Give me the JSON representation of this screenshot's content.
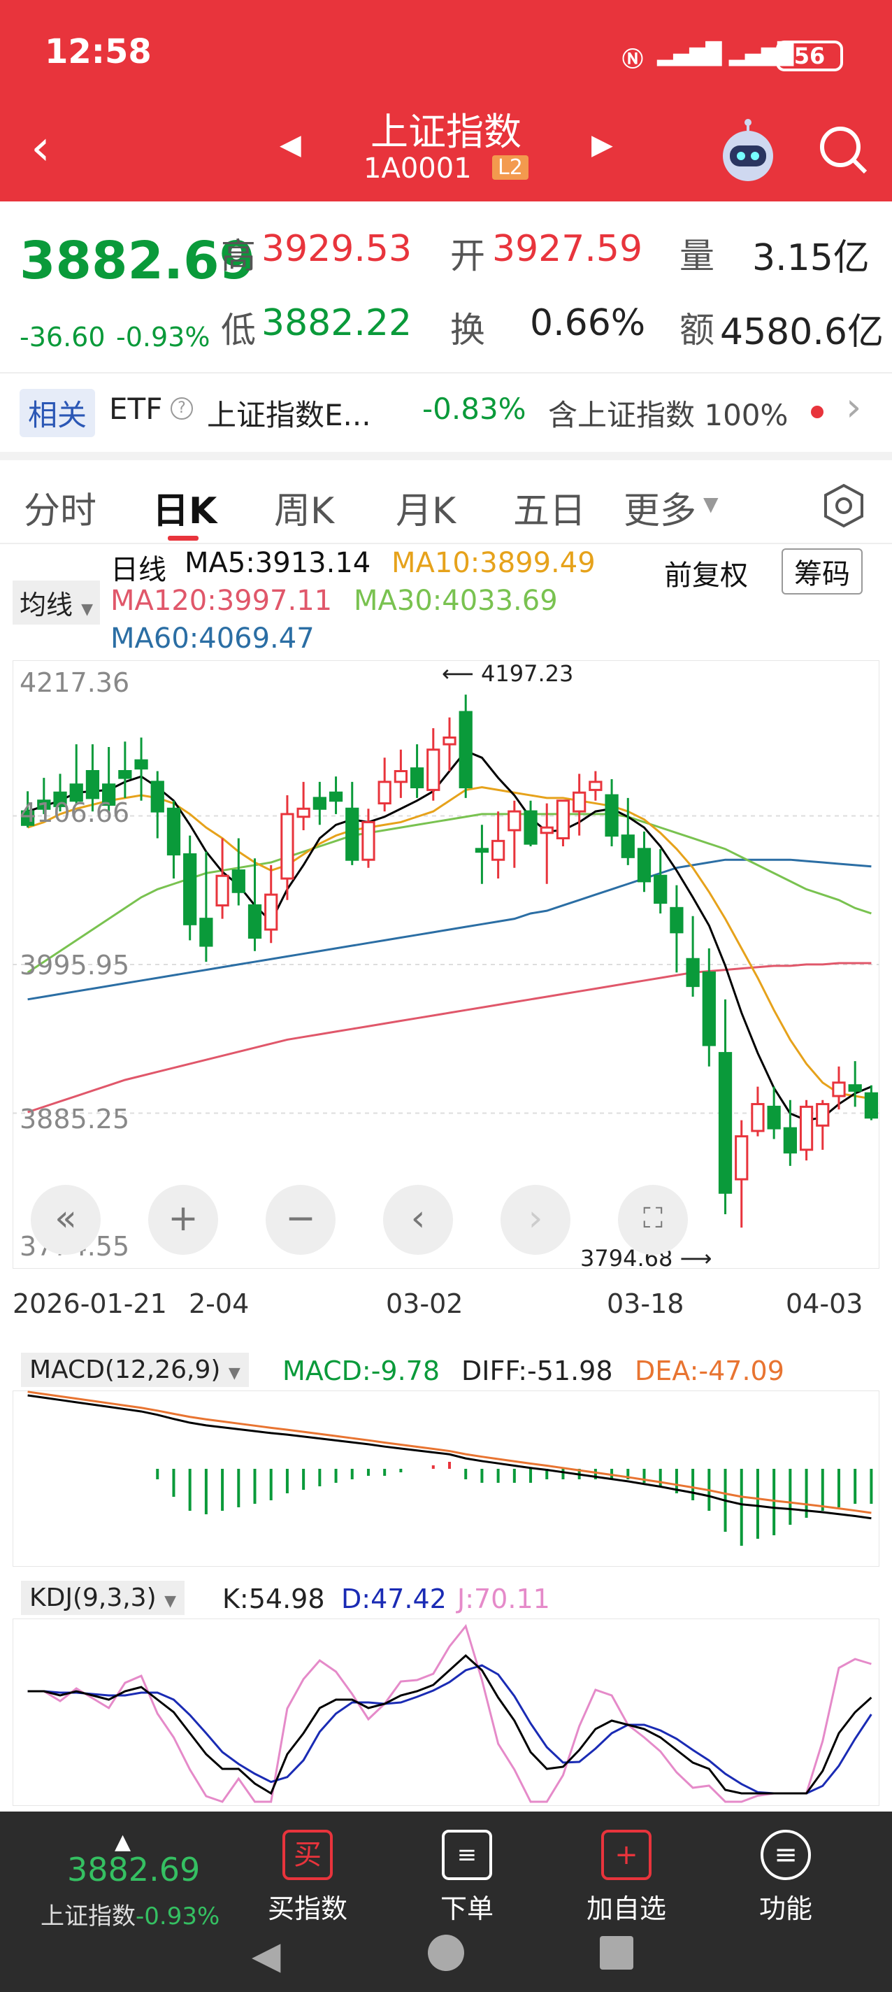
{
  "status": {
    "time": "12:58",
    "signal": "5A 5A",
    "battery": "56"
  },
  "nav": {
    "title": "上证指数",
    "code": "1A0001",
    "badge": "L2"
  },
  "quote": {
    "price": "3882.69",
    "change": "-36.60",
    "change_pct": "-0.93%",
    "high_label": "高",
    "high": "3929.53",
    "low_label": "低",
    "low": "3882.22",
    "open_label": "开",
    "open": "3927.59",
    "turnover_label": "换",
    "turnover": "0.66%",
    "volume_label": "量",
    "volume": "3.15亿",
    "amount_label": "额",
    "amount": "4580.6亿"
  },
  "related": {
    "tag": "相关",
    "etf_label": "ETF",
    "etf_name": "上证指数E...",
    "etf_change": "-0.83%",
    "contains": "含上证指数 100%"
  },
  "tabs": [
    "分时",
    "日K",
    "周K",
    "月K",
    "五日",
    "更多"
  ],
  "chart": {
    "line_type": "日线",
    "ma5": "MA5:3913.14",
    "ma10": "MA10:3899.49",
    "ma120": "MA120:3997.11",
    "ma30": "MA30:4033.69",
    "ma60": "MA60:4069.47",
    "adjust": "前复权",
    "chip_button": "筹码",
    "avg_dropdown": "均线",
    "y_ticks": [
      "4217.36",
      "4106.66",
      "3995.95",
      "3885.25",
      "3774.55"
    ],
    "max_label": "4197.23",
    "min_label": "3794.68",
    "x_ticks": [
      "2026-01-21",
      "2-04",
      "03-02",
      "03-18",
      "04-03"
    ],
    "colors": {
      "up": "#e8343c",
      "down": "#0a9a3a",
      "ma5": "#000000",
      "ma10": "#e6a21b",
      "ma30": "#79c250",
      "ma60": "#2b6ea4",
      "ma120": "#e0576a"
    }
  },
  "chart_data": {
    "type": "candlestick",
    "ylim": [
      3774.55,
      4217.36
    ],
    "candles": [
      [
        4110,
        4125,
        4100,
        4098
      ],
      [
        4118,
        4135,
        4112,
        4108
      ],
      [
        4124,
        4138,
        4114,
        4110
      ],
      [
        4130,
        4160,
        4118,
        4115
      ],
      [
        4140,
        4160,
        4120,
        4110
      ],
      [
        4130,
        4158,
        4115,
        4110
      ],
      [
        4140,
        4162,
        4135,
        4120
      ],
      [
        4148,
        4165,
        4142,
        4118
      ],
      [
        4132,
        4140,
        4110,
        4090
      ],
      [
        4112,
        4118,
        4078,
        4060
      ],
      [
        4078,
        4092,
        4026,
        4014
      ],
      [
        4030,
        4080,
        4010,
        3998
      ],
      [
        4040,
        4090,
        4062,
        4030
      ],
      [
        4066,
        4090,
        4050,
        4040
      ],
      [
        4040,
        4075,
        4016,
        4006
      ],
      [
        4022,
        4070,
        4048,
        4012
      ],
      [
        4060,
        4122,
        4108,
        4044
      ],
      [
        4106,
        4132,
        4112,
        4096
      ],
      [
        4120,
        4132,
        4112,
        4100
      ],
      [
        4124,
        4136,
        4118,
        4108
      ],
      [
        4112,
        4132,
        4074,
        4070
      ],
      [
        4074,
        4112,
        4102,
        4068
      ],
      [
        4116,
        4150,
        4132,
        4110
      ],
      [
        4132,
        4156,
        4140,
        4120
      ],
      [
        4142,
        4160,
        4128,
        4120
      ],
      [
        4126,
        4172,
        4156,
        4118
      ],
      [
        4160,
        4180,
        4165,
        4140
      ],
      [
        4184,
        4197,
        4128,
        4120
      ],
      [
        4082,
        4100,
        4080,
        4056
      ],
      [
        4074,
        4110,
        4088,
        4060
      ],
      [
        4096,
        4118,
        4110,
        4068
      ],
      [
        4110,
        4118,
        4086,
        4084
      ],
      [
        4094,
        4116,
        4098,
        4056
      ],
      [
        4090,
        4118,
        4118,
        4084
      ],
      [
        4110,
        4138,
        4124,
        4092
      ],
      [
        4126,
        4140,
        4132,
        4118
      ],
      [
        4122,
        4134,
        4092,
        4084
      ],
      [
        4092,
        4120,
        4076,
        4070
      ],
      [
        4082,
        4095,
        4058,
        4050
      ],
      [
        4062,
        4082,
        4042,
        4034
      ],
      [
        4038,
        4055,
        4020,
        3990
      ],
      [
        4000,
        4032,
        3980,
        3972
      ],
      [
        3990,
        4008,
        3936,
        3920
      ],
      [
        3930,
        3970,
        3826,
        3810
      ],
      [
        3836,
        3880,
        3868,
        3800
      ],
      [
        3872,
        3905,
        3892,
        3868
      ],
      [
        3890,
        3905,
        3874,
        3866
      ],
      [
        3874,
        3895,
        3856,
        3846
      ],
      [
        3858,
        3895,
        3890,
        3850
      ],
      [
        3876,
        3895,
        3892,
        3858
      ],
      [
        3898,
        3920,
        3908,
        3888
      ],
      [
        3906,
        3924,
        3902,
        3890
      ],
      [
        3900,
        3906,
        3882,
        3880
      ]
    ],
    "ma5": [
      4110,
      4114,
      4118,
      4124,
      4125,
      4126,
      4132,
      4136,
      4128,
      4118,
      4100,
      4080,
      4065,
      4055,
      4040,
      4028,
      4052,
      4070,
      4090,
      4100,
      4104,
      4102,
      4106,
      4112,
      4118,
      4125,
      4140,
      4155,
      4150,
      4135,
      4122,
      4105,
      4095,
      4096,
      4102,
      4110,
      4112,
      4106,
      4098,
      4084,
      4066,
      4046,
      4025,
      3995,
      3960,
      3930,
      3904,
      3885,
      3880,
      3882,
      3892,
      3900,
      3905
    ],
    "ma10": [
      4098,
      4102,
      4108,
      4112,
      4115,
      4118,
      4120,
      4122,
      4120,
      4116,
      4108,
      4098,
      4090,
      4080,
      4072,
      4066,
      4070,
      4078,
      4086,
      4092,
      4096,
      4098,
      4100,
      4102,
      4106,
      4110,
      4118,
      4126,
      4128,
      4126,
      4124,
      4122,
      4120,
      4120,
      4118,
      4116,
      4114,
      4110,
      4104,
      4094,
      4082,
      4068,
      4050,
      4030,
      4008,
      3986,
      3962,
      3940,
      3922,
      3908,
      3900,
      3898,
      3896
    ],
    "ma30": [
      3990,
      3998,
      4006,
      4014,
      4022,
      4030,
      4038,
      4046,
      4052,
      4056,
      4060,
      4064,
      4066,
      4068,
      4070,
      4072,
      4076,
      4080,
      4084,
      4088,
      4092,
      4094,
      4096,
      4098,
      4100,
      4102,
      4104,
      4106,
      4108,
      4108,
      4108,
      4108,
      4108,
      4108,
      4108,
      4108,
      4108,
      4106,
      4102,
      4098,
      4094,
      4090,
      4086,
      4082,
      4076,
      4070,
      4064,
      4058,
      4052,
      4048,
      4044,
      4038,
      4034
    ],
    "ma60": [
      3970,
      3972,
      3974,
      3976,
      3978,
      3980,
      3982,
      3984,
      3986,
      3988,
      3990,
      3992,
      3994,
      3996,
      3998,
      4000,
      4002,
      4004,
      4006,
      4008,
      4010,
      4012,
      4014,
      4016,
      4018,
      4020,
      4022,
      4024,
      4026,
      4028,
      4030,
      4034,
      4036,
      4040,
      4044,
      4048,
      4052,
      4056,
      4060,
      4064,
      4068,
      4070,
      4072,
      4074,
      4074,
      4074,
      4074,
      4074,
      4073,
      4072,
      4071,
      4070,
      4069
    ],
    "ma120": [
      3886,
      3890,
      3894,
      3898,
      3902,
      3906,
      3910,
      3913,
      3916,
      3919,
      3922,
      3925,
      3928,
      3931,
      3934,
      3937,
      3940,
      3942,
      3944,
      3946,
      3948,
      3950,
      3952,
      3954,
      3956,
      3958,
      3960,
      3962,
      3964,
      3966,
      3968,
      3970,
      3972,
      3974,
      3976,
      3978,
      3980,
      3982,
      3984,
      3986,
      3988,
      3990,
      3991,
      3992,
      3993,
      3994,
      3995,
      3995,
      3996,
      3996,
      3997,
      3997,
      3997
    ],
    "macd": {
      "label": "MACD(12,26,9)",
      "macd": "MACD:-9.78",
      "diff": "DIFF:-51.98",
      "dea": "DEA:-47.09",
      "bars": [
        0,
        0,
        0,
        0,
        0,
        0,
        0,
        0,
        -3,
        -8,
        -12,
        -13,
        -12,
        -11,
        -10,
        -9,
        -7,
        -6,
        -5,
        -4,
        -3,
        -2,
        -2,
        -1,
        0,
        1,
        2,
        -3,
        -4,
        -4,
        -4,
        -4,
        -3,
        -3,
        -3,
        -3,
        -3,
        -3,
        -4,
        -5,
        -7,
        -9,
        -12,
        -18,
        -22,
        -20,
        -19,
        -16,
        -14,
        -12,
        -11,
        -10,
        -10
      ]
    },
    "kdj": {
      "label": "KDJ(9,3,3)",
      "k": "K:54.98",
      "d": "D:47.42",
      "j": "J:70.11"
    }
  },
  "bottom": {
    "price": "3882.69",
    "name": "上证指数",
    "pct": "-0.93%",
    "buy": "买指数",
    "order": "下单",
    "watch": "加自选",
    "func": "功能"
  }
}
